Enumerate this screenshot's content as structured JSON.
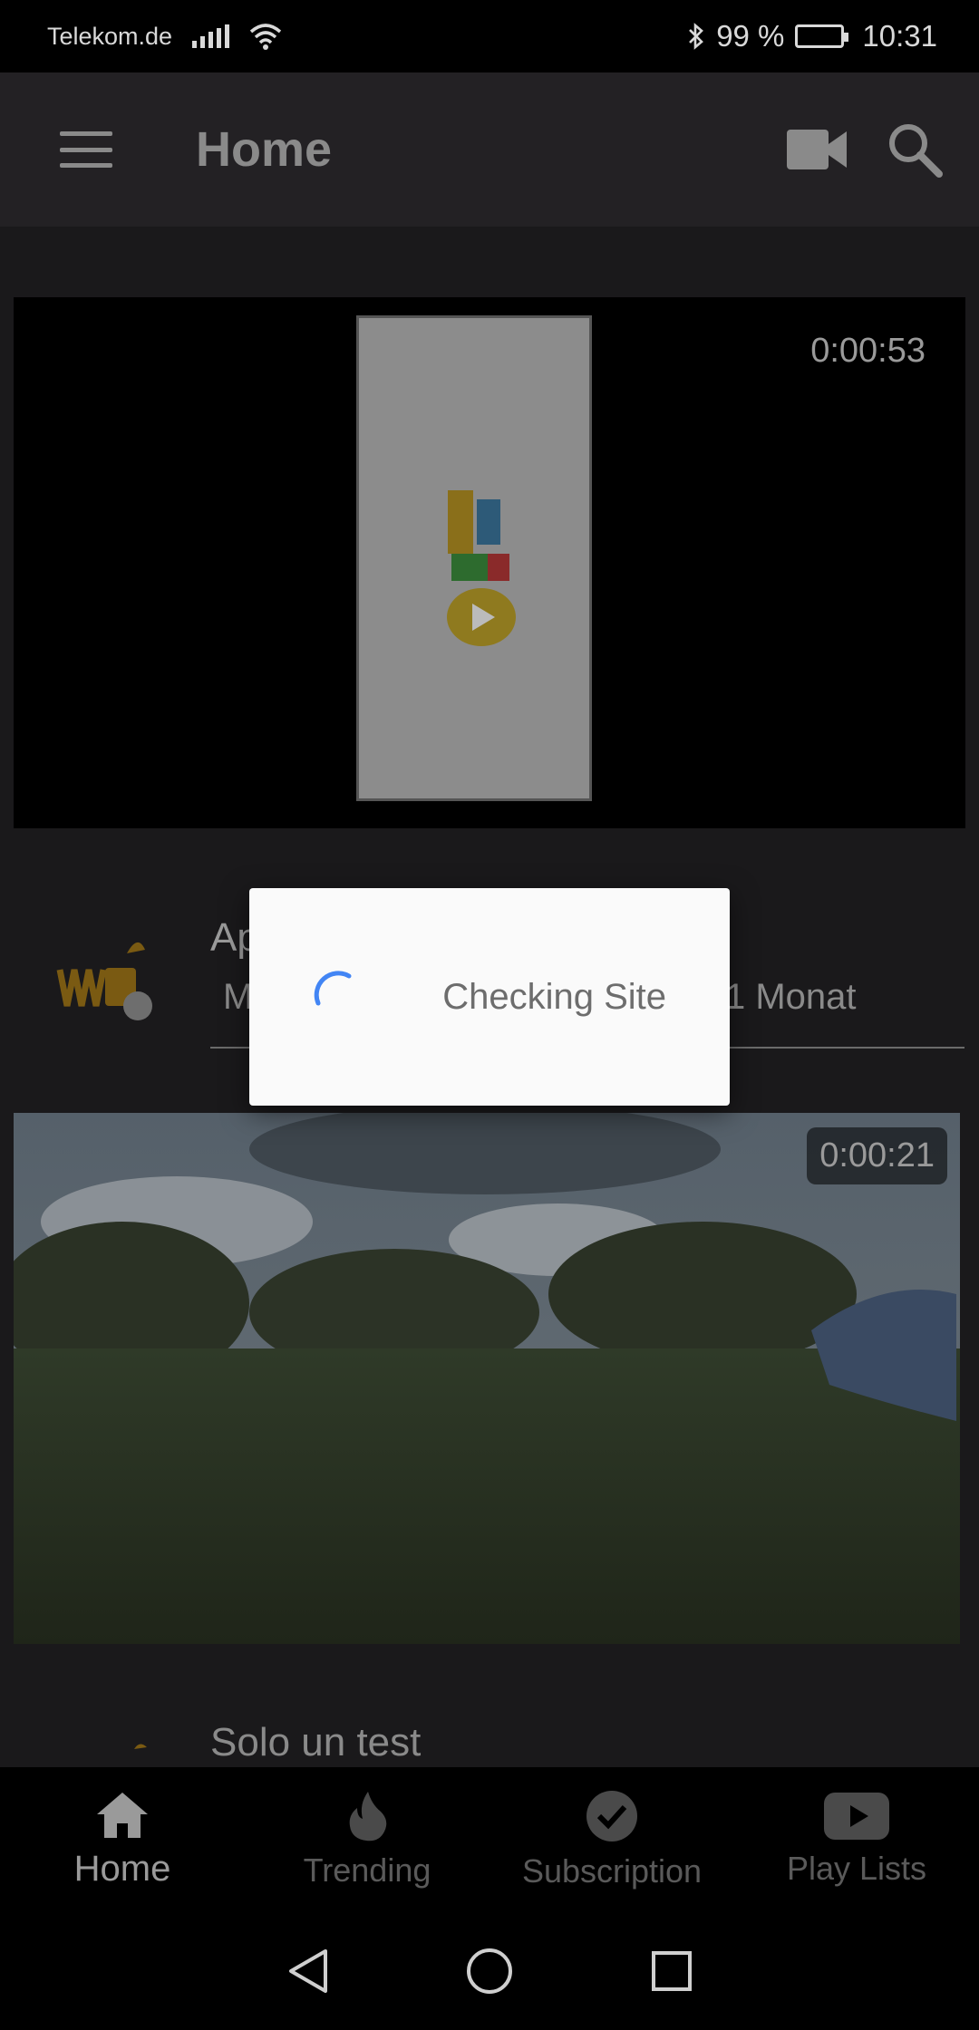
{
  "status_bar": {
    "carrier": "Telekom.de",
    "battery": "99 %",
    "time": "10:31"
  },
  "app_bar": {
    "title": "Home"
  },
  "feed": {
    "videos": [
      {
        "duration": "0:00:53",
        "title_partial": "Ap",
        "subtitle_partial": "M",
        "age": "1 Monat"
      },
      {
        "duration": "0:00:21",
        "title": "Solo un test"
      }
    ]
  },
  "bottom_nav": {
    "items": [
      {
        "label": "Home",
        "icon": "home-icon",
        "active": true
      },
      {
        "label": "Trending",
        "icon": "fire-icon",
        "active": false
      },
      {
        "label": "Subscription",
        "icon": "check-circle-icon",
        "active": false
      },
      {
        "label": "Play Lists",
        "icon": "youtube-play-icon",
        "active": false
      }
    ]
  },
  "dialog": {
    "message": "Checking Site"
  },
  "colors": {
    "accent_spinner": "#4285f4",
    "dialog_bg": "#fafafa",
    "app_bar_bg": "#232124"
  }
}
